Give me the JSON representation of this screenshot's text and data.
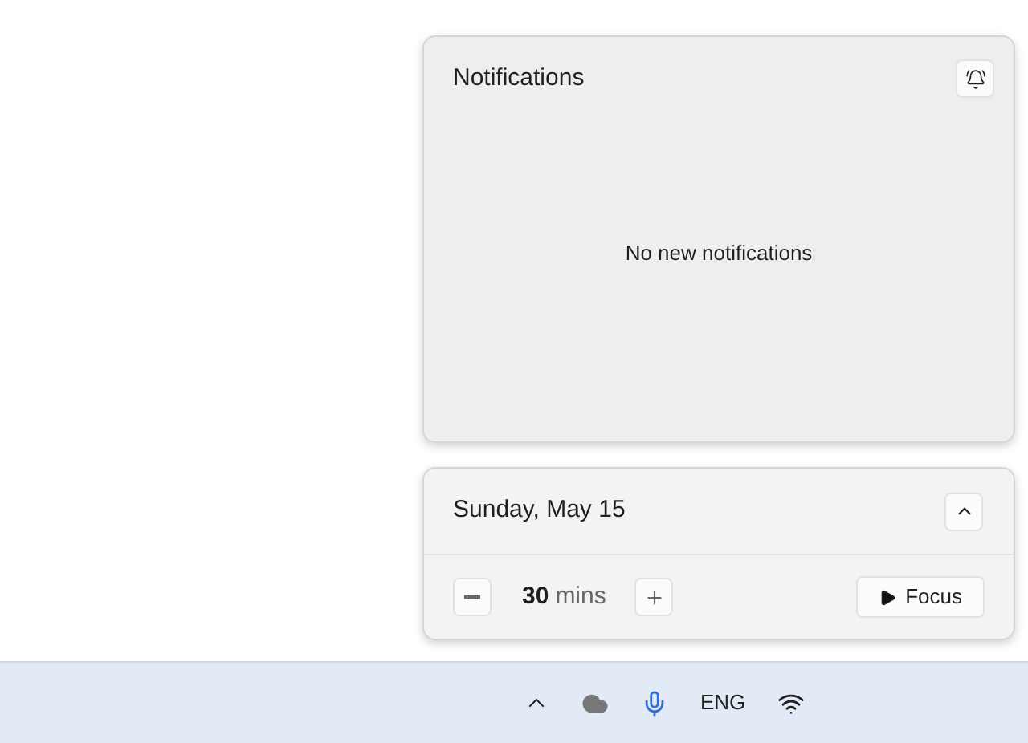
{
  "notifications": {
    "title": "Notifications",
    "empty_message": "No new notifications"
  },
  "calendar": {
    "date": "Sunday, May 15",
    "expanded": true
  },
  "focus": {
    "duration": "30",
    "unit": "mins",
    "button": "Focus"
  },
  "taskbar": {
    "language": "ENG"
  }
}
